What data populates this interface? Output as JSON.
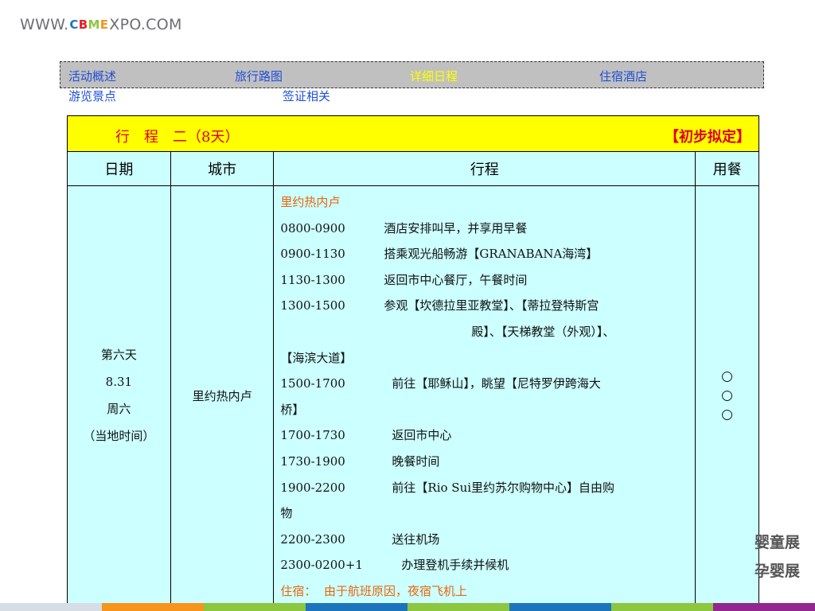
{
  "logo": {
    "prefix": "WWW.",
    "brand_letters": [
      "C",
      "B",
      "M",
      "E"
    ],
    "suffix": "XPO.COM",
    "colors": [
      "#1c75bc",
      "#ed1c24",
      "#8dc63f",
      "#f7941d"
    ]
  },
  "nav": {
    "items": [
      {
        "label": "活动概述",
        "active": false
      },
      {
        "label": "旅行路图",
        "active": false
      },
      {
        "label": "详细日程",
        "active": true
      },
      {
        "label": "住宿酒店",
        "active": false
      },
      {
        "label": "游览景点",
        "active": false
      },
      {
        "label": "签证相关",
        "active": false
      }
    ]
  },
  "table": {
    "title": "行　程　二（8天）",
    "status": "【初步拟定】",
    "headers": [
      "日期",
      "城市",
      "行程",
      "用餐"
    ],
    "day": {
      "label": "第六天",
      "date": "8.31",
      "weekday": "周六",
      "note": "（当地时间）"
    },
    "city": "里约热内卢",
    "schedule_heading": "里约热内卢",
    "schedule": [
      {
        "time": "0800-0900",
        "activity": "酒店安排叫早，并享用早餐"
      },
      {
        "time": "0900-1130",
        "activity": "搭乘观光船畅游【GRANABANA海湾】"
      },
      {
        "time": "1130-1300",
        "activity": "返回市中心餐厅，午餐时间"
      },
      {
        "time": "1300-1500",
        "activity": "参观【坎德拉里亚教堂】、【蒂拉登特斯宫"
      },
      {
        "time": "",
        "activity": "殿】、【天梯教堂（外观）】、"
      },
      {
        "time": "",
        "activity": "【海滨大道】"
      },
      {
        "time": "1500-1700",
        "activity": "前往【耶稣山】，眺望【尼特罗伊跨海大"
      },
      {
        "time": "",
        "activity": "桥】"
      },
      {
        "time": "1700-1730",
        "activity": "返回市中心"
      },
      {
        "time": "1730-1900",
        "activity": "晚餐时间"
      },
      {
        "time": "1900-2200",
        "activity": "前往【Rio Sui里约苏尔购物中心】自由购"
      },
      {
        "time": "",
        "activity": "物"
      },
      {
        "time": "2200-2300",
        "activity": "送往机场"
      },
      {
        "time": "2300-0200+1",
        "activity": "办理登机手续并候机"
      }
    ],
    "lodging_label": "住宿：",
    "lodging_value": "由于航班原因，夜宿飞机上",
    "meals": [
      "○",
      "○",
      "○"
    ]
  },
  "side_texts": [
    "婴童展",
    "孕婴展"
  ],
  "colors": {
    "nav_bg": "#c0c0c0",
    "nav_link": "#1f4ed8",
    "nav_active": "#ffff00",
    "title_bg": "#ffff00",
    "title_text": "#e0001b",
    "table_bg": "#ccffff",
    "highlight_text": "#e8660b",
    "bottom_bar": [
      "#d7dde4",
      "#f7941d",
      "#8dc63f",
      "#1c75bc",
      "#8dc63f",
      "#1c75bc",
      "#8dc63f",
      "#92278f"
    ]
  }
}
